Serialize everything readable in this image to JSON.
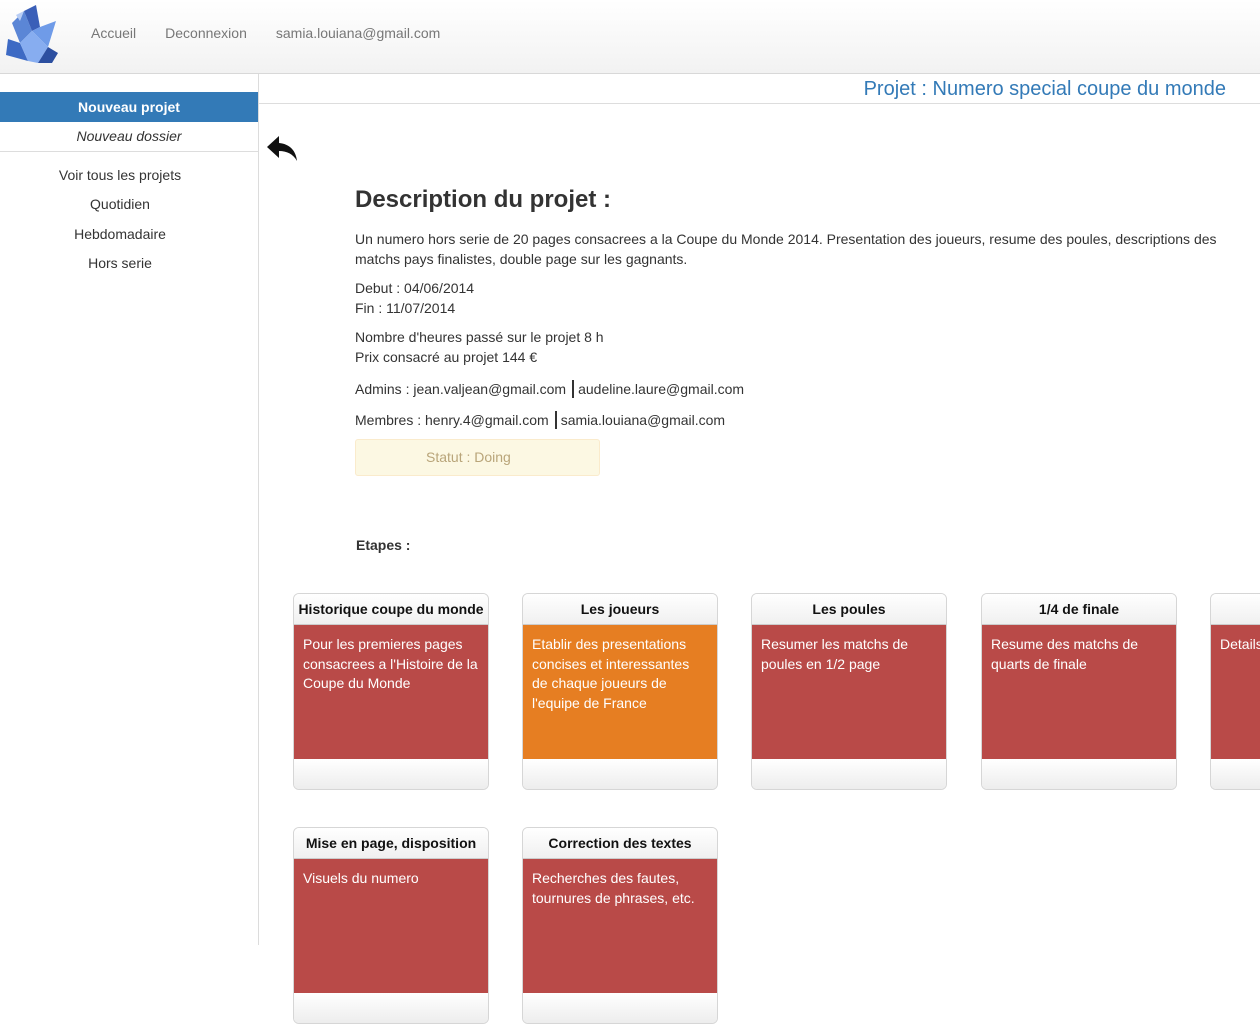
{
  "topnav": {
    "home": "Accueil",
    "logout": "Deconnexion",
    "user_email": "samia.louiana@gmail.com"
  },
  "sidebar": {
    "new_project": "Nouveau projet",
    "new_folder": "Nouveau dossier",
    "items": [
      {
        "label": "Voir tous les projets"
      },
      {
        "label": "Quotidien"
      },
      {
        "label": "Hebdomadaire"
      },
      {
        "label": "Hors serie"
      }
    ]
  },
  "project": {
    "title": "Projet : Numero special coupe du monde",
    "desc_heading": "Description du projet :",
    "description": "Un numero hors serie de 20 pages consacrees a la Coupe du Monde 2014. Presentation des joueurs, resume des poules, descriptions des matchs pays finalistes, double page sur les gagnants.",
    "start": "Debut : 04/06/2014",
    "end": "Fin : 11/07/2014",
    "hours": "Nombre d'heures passé sur le projet 8 h",
    "price": "Prix consacré au projet 144 €",
    "admins_label": "Admins : ",
    "admins": [
      "jean.valjean@gmail.com",
      "audeline.laure@gmail.com"
    ],
    "members_label": "Membres : ",
    "members": [
      "henry.4@gmail.com",
      "samia.louiana@gmail.com"
    ],
    "status": "Statut : Doing",
    "steps_label": "Etapes :"
  },
  "steps": [
    {
      "title": "Historique coupe du monde",
      "text": "Pour les premieres pages consacrees a l'Histoire de la Coupe du Monde",
      "color": "#b94a48"
    },
    {
      "title": "Les joueurs",
      "text": "Etablir des presentations concises et interessantes de chaque joueurs de l'equipe de France",
      "color": "#e67e22"
    },
    {
      "title": "Les poules",
      "text": "Resumer les matchs de poules en 1/2 page",
      "color": "#b94a48"
    },
    {
      "title": "1/4 de finale",
      "text": "Resume des matchs de quarts de finale",
      "color": "#b94a48"
    },
    {
      "title": "",
      "text": "Details deux e",
      "color": "#b94a48"
    },
    {
      "title": "Mise en page, disposition",
      "text": "Visuels du numero",
      "color": "#b94a48"
    },
    {
      "title": "Correction des textes",
      "text": "Recherches des fautes, tournures de phrases, etc.",
      "color": "#b94a48"
    }
  ],
  "colors": {
    "accent": "#337ab7",
    "step_red": "#b94a48",
    "step_orange": "#e67e22"
  }
}
